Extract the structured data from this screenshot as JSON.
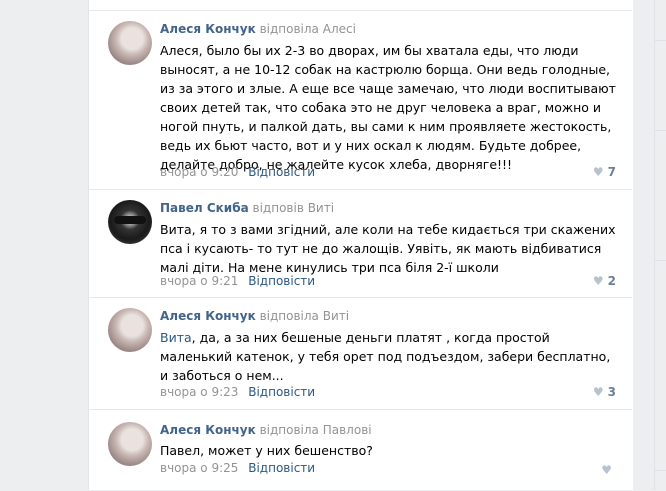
{
  "comments": [
    {
      "author": "Алеся Кончук",
      "reply_to": "відповіла Алесі",
      "text": "Алеся, было бы их 2-3 во дворах, им бы хватала еды, что люди выносят, а не 10-12 собак на кастрюлю борща. Они ведь голодные, из за этого и злые. А еще все чаще замечаю, что люди воспитывают своих детей так, что собака это не друг человека а враг, можно и ногой пнуть, и палкой дать, вы сами к ним проявляете жестокость, ведь их бьют часто, вот и у них оскал к людям. Будьте добрее, делайте добро, не жалейте кусок хлеба, дворняге!!!",
      "time": "вчора о 9:20",
      "reply_label": "Відповісти",
      "likes": "7"
    },
    {
      "author": "Павел Скиба",
      "reply_to": "відповів Виті",
      "text": "Вита, я то з вами згідний, але коли на тебе кидається три скажених пса і кусають- то тут не до жалощів. Уявіть, як мають відбиватися малі діти. На мене кинулись три пса біля 2-ї школи",
      "time": "вчора о 9:21",
      "reply_label": "Відповісти",
      "likes": "2"
    },
    {
      "author": "Алеся Кончук",
      "reply_to": "відповіла Виті",
      "mention": "Вита",
      "text": ", да, а за них бешеные деньги платят , когда простой маленький катенок, у тебя орет под подъездом, забери бесплатно, и заботься о нем...",
      "time": "вчора о 9:23",
      "reply_label": "Відповісти",
      "likes": "3"
    },
    {
      "author": "Алеся Кончук",
      "reply_to": "відповіла Павлові",
      "text": "Павел, может у них бешенство?",
      "time": "вчора о 9:25",
      "reply_label": "Відповісти",
      "likes": ""
    }
  ],
  "colors": {
    "link": "#2a5885",
    "author": "#42648b",
    "muted": "#939393"
  },
  "icons": {
    "like": "heart-icon"
  }
}
